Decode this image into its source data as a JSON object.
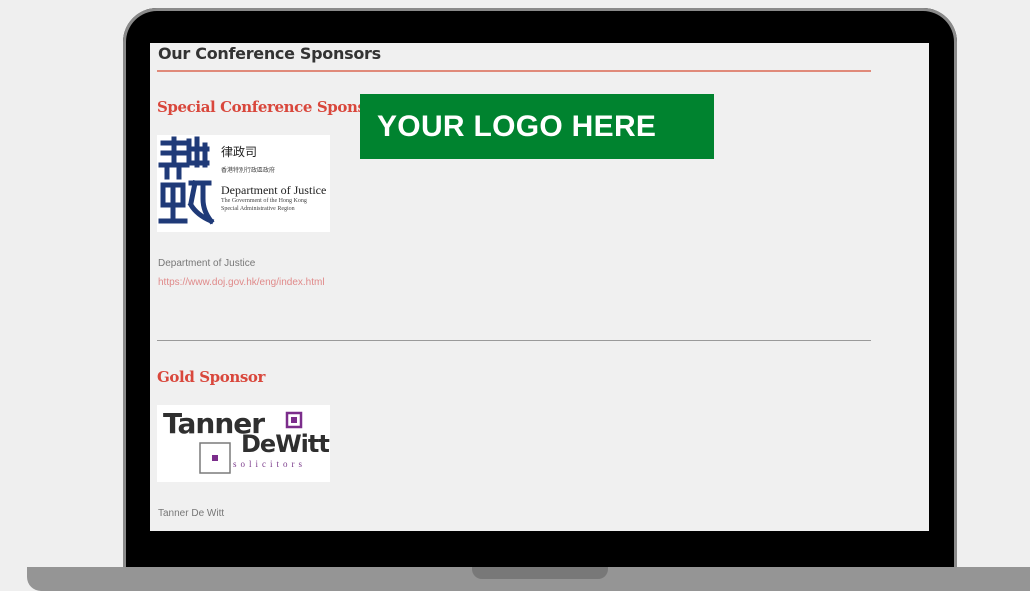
{
  "page": {
    "heading": "Our Conference Sponsors",
    "badge_text": "YOUR LOGO HERE"
  },
  "sections": [
    {
      "title": "Special Conference Sponsor",
      "sponsor_name": "Department of Justice",
      "sponsor_link": "https://www.doj.gov.hk/eng/index.html",
      "logo": {
        "chinese_name": "律政司",
        "chinese_subtitle": "香港特別行政區政府",
        "english_name": "Department of Justice",
        "line1": "The Government of the Hong Kong",
        "line2": "Special Administrative Region"
      }
    },
    {
      "title": "Gold Sponsor",
      "sponsor_name": "Tanner De Witt",
      "logo": {
        "word1": "Tanner",
        "word2": "DeWitt",
        "word3": "solicitors",
        "accent_color": "#7b2d8b"
      }
    }
  ],
  "colors": {
    "accent_red": "#d9473c",
    "badge_green": "#00832f",
    "doj_blue": "#1f3a78"
  }
}
